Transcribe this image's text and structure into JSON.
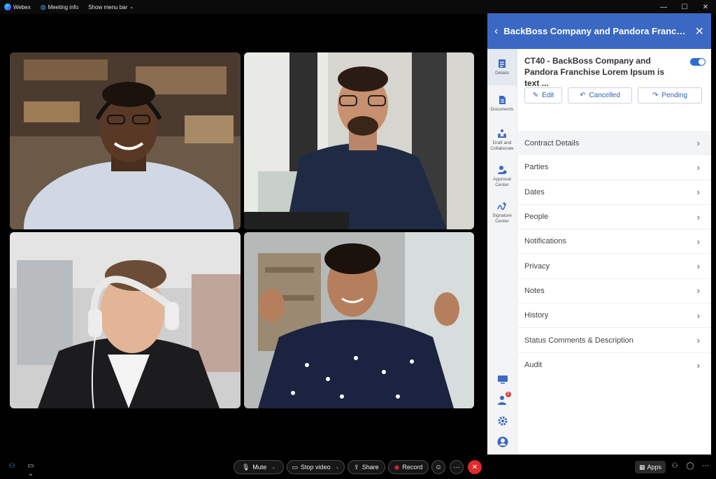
{
  "titlebar": {
    "app_name": "Webex",
    "meeting_info": "Meeting info",
    "show_menu_bar": "Show menu bar",
    "minimize": "—",
    "maximize": "☐",
    "close": "✕"
  },
  "panel": {
    "header_title": "BackBoss Company and Pandora Franchise...",
    "nav": [
      {
        "label": "Details",
        "icon": "details-icon"
      },
      {
        "label": "Documents",
        "icon": "documents-icon"
      },
      {
        "label": "Draft and Collaborate",
        "icon": "collaborate-icon"
      },
      {
        "label": "Approval Center",
        "icon": "approval-icon"
      },
      {
        "label": "Signature Center",
        "icon": "signature-icon"
      }
    ],
    "record_title": "CT40 - BackBoss Company and Pandora Franchise Lorem Ipsum is text ...",
    "toggle_on": true,
    "actions": {
      "edit": "Edit",
      "cancelled": "Cancelled",
      "pending": "Pending"
    },
    "sections": [
      "Contract Details",
      "Parties",
      "Dates",
      "People",
      "Notifications",
      "Privacy",
      "Notes",
      "History",
      "Status Comments & Description",
      "Audit"
    ],
    "notification_count": "3",
    "accent_color": "#3b68c2"
  },
  "controls": {
    "mute": "Mute",
    "stop_video": "Stop video",
    "share": "Share",
    "record": "Record",
    "more": "···",
    "end": "✕",
    "apps": "Apps"
  }
}
